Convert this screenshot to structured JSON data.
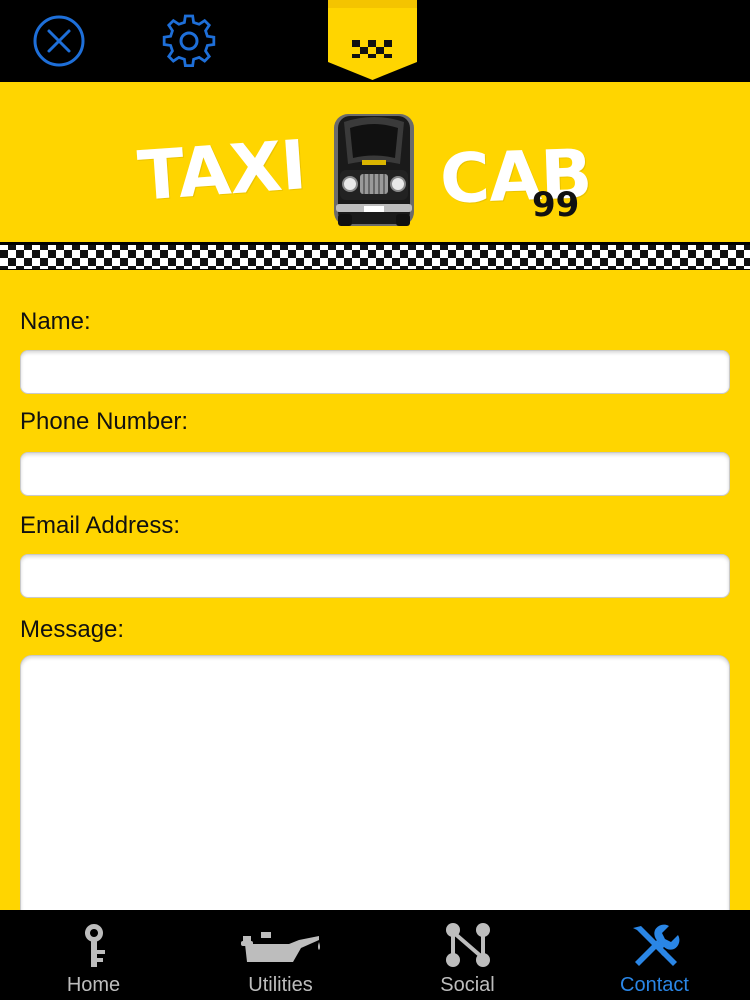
{
  "topbar": {
    "close_icon": "close-circle-icon",
    "settings_icon": "gear-icon",
    "badge_icon": "taxi-checker-badge-icon",
    "icon_color": "#1e6fd9"
  },
  "logo": {
    "word_left": "TAXI",
    "word_right": "CAB",
    "number": "99",
    "image": "taxi-car-icon"
  },
  "form": {
    "name_label": "Name:",
    "name_value": "",
    "phone_label": "Phone Number:",
    "phone_value": "",
    "email_label": "Email Address:",
    "email_value": "",
    "message_label": "Message:",
    "message_value": ""
  },
  "tabs": [
    {
      "label": "Home",
      "icon": "key-icon",
      "active": false
    },
    {
      "label": "Utilities",
      "icon": "oil-can-icon",
      "active": false
    },
    {
      "label": "Social",
      "icon": "social-network-icon",
      "active": false
    },
    {
      "label": "Contact",
      "icon": "tools-icon",
      "active": true
    }
  ],
  "colors": {
    "background": "#ffd500",
    "bars": "#000000",
    "active_tab": "#2a86e6",
    "inactive_tab": "#bdbdbd"
  }
}
